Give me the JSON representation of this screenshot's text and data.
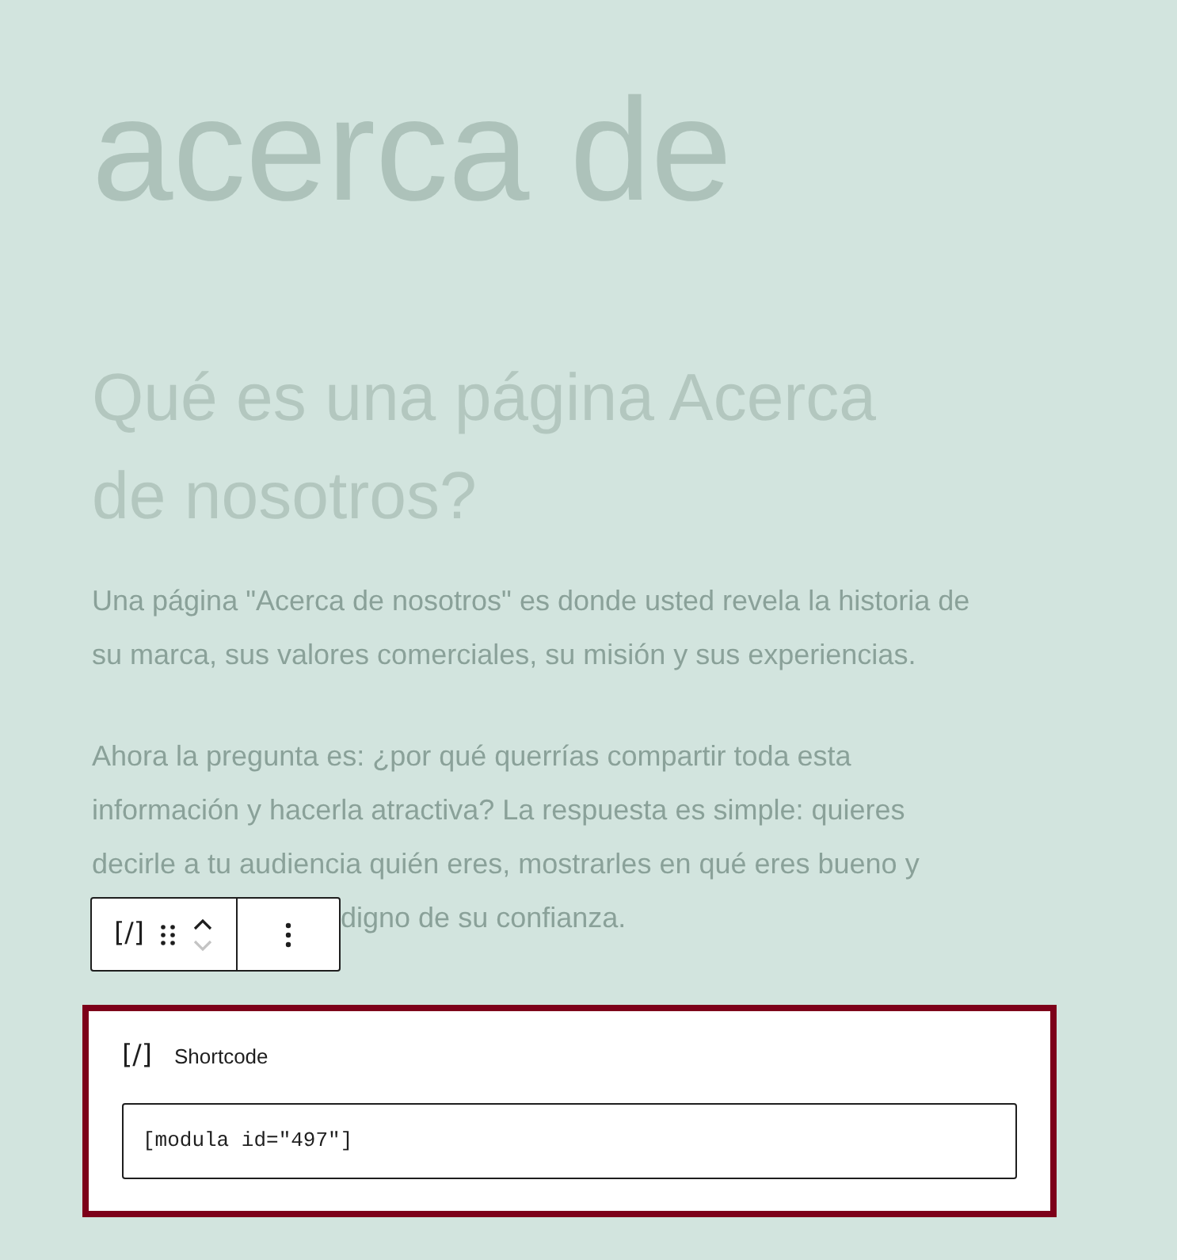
{
  "title": "acerca de",
  "heading_lines": [
    "Qué es una página Acerca",
    "de nosotros?"
  ],
  "paragraphs": [
    {
      "lines": [
        "Una página \"Acerca de nosotros\" es donde usted revela la historia de",
        "su marca, sus valores comerciales, su misión y sus experiencias."
      ]
    },
    {
      "lines": [
        "Ahora la pregunta es: ¿por qué querrías compartir toda esta",
        "información y hacerla atractiva? La respuesta es simple: quieres",
        "decirle a tu audiencia quién eres, mostrarles en qué eres bueno y",
        "digno de su confianza."
      ]
    }
  ],
  "toolbar": {
    "block_icon": "[/]",
    "move_up": {
      "disabled": false
    },
    "move_down": {
      "disabled": true
    }
  },
  "block": {
    "icon": "[/]",
    "label": "Shortcode",
    "value": "[modula id=\"497\"]"
  }
}
